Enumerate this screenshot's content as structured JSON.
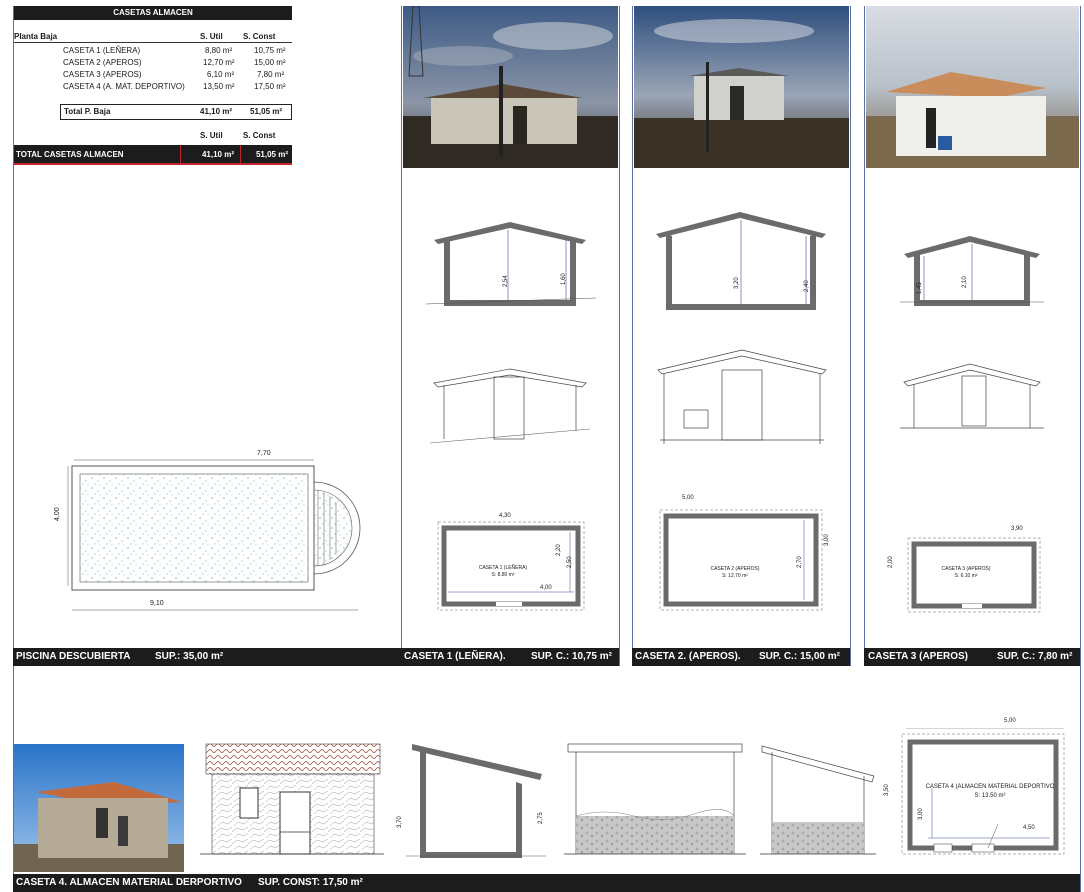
{
  "summary": {
    "title": "CASETAS ALMACEN",
    "floor_label": "Planta Baja",
    "col_util": "S. Util",
    "col_const": "S. Const",
    "rows": [
      {
        "name": "CASETA 1 (LEÑERA)",
        "util": "8,80 m²",
        "const": "10,75 m²"
      },
      {
        "name": "CASETA 2 (APEROS)",
        "util": "12,70 m²",
        "const": "15,00 m²"
      },
      {
        "name": "CASETA 3 (APEROS)",
        "util": "6,10 m²",
        "const": "7,80 m²"
      },
      {
        "name": "CASETA 4 (A. MAT. DEPORTIVO)",
        "util": "13,50 m²",
        "const": "17,50 m²"
      }
    ],
    "subtotal": {
      "name": "Total P. Baja",
      "util": "41,10 m²",
      "const": "51,05 m²"
    },
    "col_util_2": "S. Util",
    "col_const_2": "S. Const",
    "total": {
      "name": "TOTAL CASETAS ALMACEN",
      "util": "41,10 m²",
      "const": "51,05 m²"
    }
  },
  "pool": {
    "dim_width": "7,70",
    "dim_height": "4,00",
    "dim_total": "9,10",
    "caption": "PISCINA DESCUBIERTA",
    "area": "SUP.: 35,00 m²"
  },
  "caseta1": {
    "caption": "CASETA 1 (LEÑERA).",
    "area": "SUP. C.: 10,75 m²",
    "sec_h1": "2,54",
    "sec_h2": "1,60",
    "plan_w": "4,30",
    "plan_inner_w": "4,00",
    "plan_h1": "2,20",
    "plan_h2": "2,50",
    "room_name": "CASETA 1 (LEÑERA)",
    "room_area": "S: 8.80 m²"
  },
  "caseta2": {
    "caption": "CASETA 2. (APEROS).",
    "area": "SUP. C.: 15,00 m²",
    "sec_h1": "3,20",
    "sec_h2": "2,40",
    "plan_w": "5,00",
    "plan_h1": "2,70",
    "plan_h2": "3,00",
    "room_name": "CASETA 2 (APEROS)",
    "room_area": "S: 12.70 m²"
  },
  "caseta3": {
    "caption": "CASETA 3 (APEROS)",
    "area": "SUP. C.: 7,80 m²",
    "sec_h1": "1,45",
    "sec_h2": "2,10",
    "plan_w": "3,90",
    "plan_h": "2,00",
    "room_name": "CASETA 3 (APEROS)",
    "room_area": "S: 6.10 m²"
  },
  "caseta4": {
    "caption": "CASETA 4. ALMACEN MATERIAL DERPORTIVO",
    "area": "SUP. CONST:  17,50 m²",
    "sec_h1": "3,70",
    "sec_h2": "2,75",
    "plan_w": "5,00",
    "plan_inner_w": "4,50",
    "plan_h1": "3,50",
    "plan_h2": "3,00",
    "room_name": "CASETA 4 (ALMACEN MATERIAL DEPORTIVO",
    "room_area": "S: 13.50 m²"
  },
  "colors": {
    "caption_bg": "#1c1c1c",
    "accent_red": "#c0272d",
    "frame_blue": "#5a6fa0",
    "wall_grey": "#6b6b6b"
  }
}
